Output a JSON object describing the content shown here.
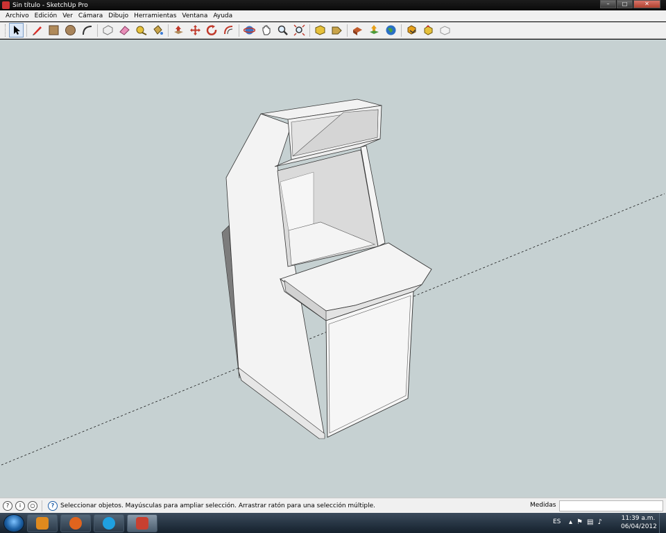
{
  "window": {
    "title": "Sin título - SketchUp Pro",
    "controls": {
      "minimize": "–",
      "maximize": "□",
      "close": "✕"
    }
  },
  "menu": [
    "Archivo",
    "Edición",
    "Ver",
    "Cámara",
    "Dibujo",
    "Herramientas",
    "Ventana",
    "Ayuda"
  ],
  "toolbar": {
    "tools": [
      {
        "name": "select-tool-icon",
        "active": true
      },
      {
        "name": "pencil-line-icon"
      },
      {
        "name": "rectangle-icon"
      },
      {
        "name": "circle-icon"
      },
      {
        "name": "arc-icon"
      },
      {
        "name": "make-component-icon"
      },
      {
        "name": "eraser-icon"
      },
      {
        "name": "tape-measure-icon"
      },
      {
        "name": "paint-bucket-icon"
      },
      {
        "name": "push-pull-icon"
      },
      {
        "name": "move-icon"
      },
      {
        "name": "rotate-icon"
      },
      {
        "name": "offset-icon"
      },
      {
        "name": "orbit-icon"
      },
      {
        "name": "pan-icon"
      },
      {
        "name": "zoom-icon"
      },
      {
        "name": "zoom-extents-icon"
      },
      {
        "name": "previous-view-icon"
      },
      {
        "name": "next-view-icon"
      },
      {
        "name": "get-models-icon"
      },
      {
        "name": "share-model-icon"
      },
      {
        "name": "google-earth-icon"
      },
      {
        "name": "get-components-icon"
      },
      {
        "name": "share-component-icon"
      },
      {
        "name": "extension-warehouse-icon"
      }
    ]
  },
  "status": {
    "message": "Seleccionar objetos. Mayúsculas para ampliar selección. Arrastrar ratón para una selección múltiple.",
    "measurements_label": "Medidas",
    "measurements_value": ""
  },
  "taskbar": {
    "language": "ES",
    "time": "11:39 a.m.",
    "date": "06/04/2012",
    "apps": [
      {
        "name": "media-player-icon",
        "color": "#e08a1e"
      },
      {
        "name": "firefox-icon",
        "color": "#e0641e"
      },
      {
        "name": "skype-icon",
        "color": "#1fa0e0"
      },
      {
        "name": "sketchup-icon",
        "color": "#c84030",
        "active": true
      }
    ]
  },
  "colors": {
    "viewport": "#c6d1d2",
    "model_face": "#f4f4f4",
    "model_shade": "#cfcfcf",
    "model_dark": "#8a8a8a"
  }
}
